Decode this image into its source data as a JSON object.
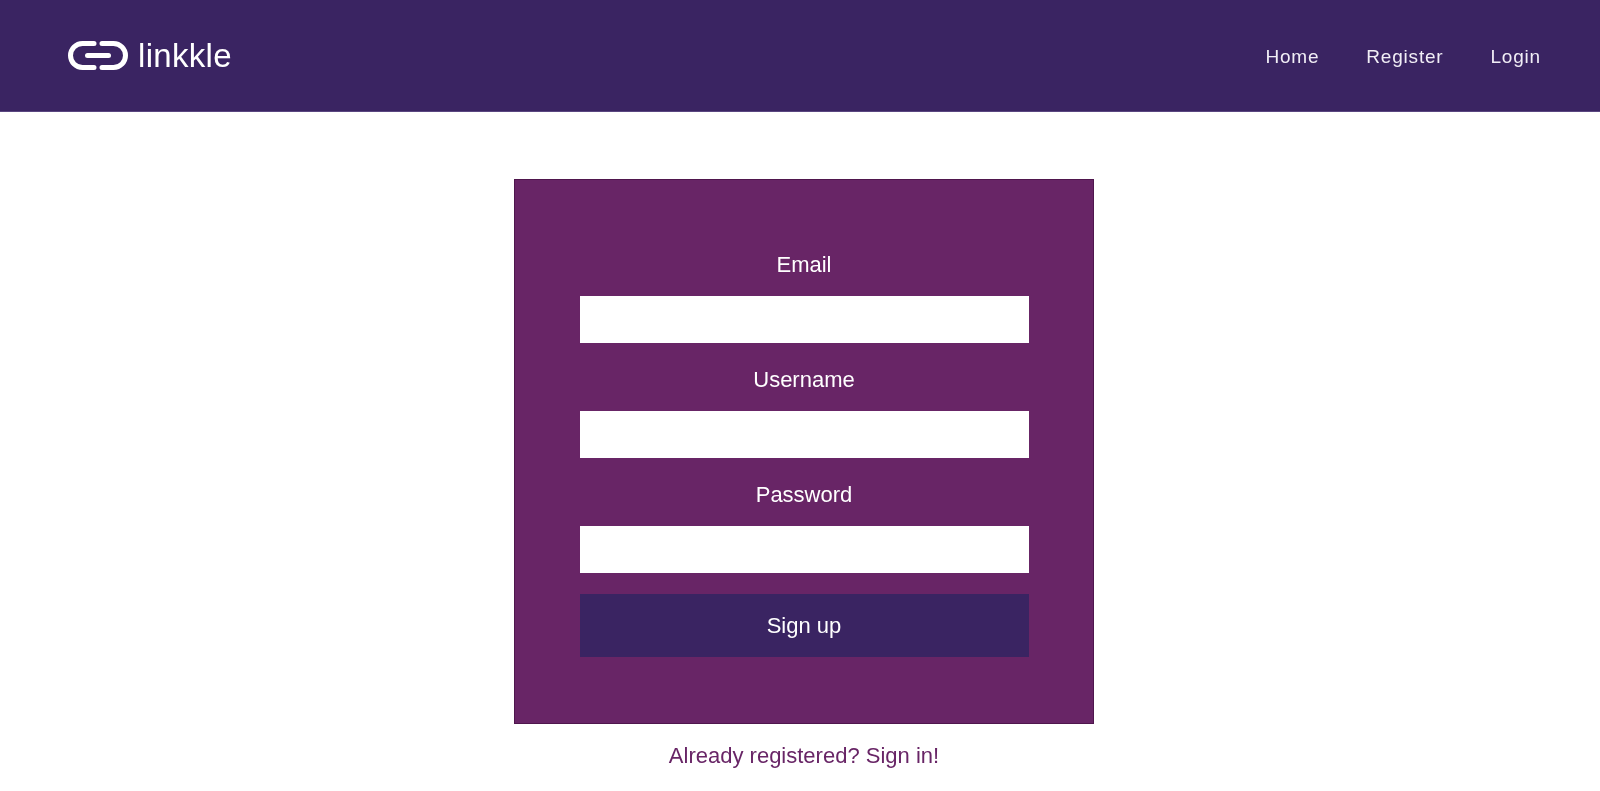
{
  "header": {
    "logo": {
      "text": "linkkle"
    },
    "nav": [
      {
        "label": "Home"
      },
      {
        "label": "Register"
      },
      {
        "label": "Login"
      }
    ]
  },
  "form": {
    "fields": [
      {
        "label": "Email"
      },
      {
        "label": "Username"
      },
      {
        "label": "Password"
      }
    ],
    "submit": {
      "label": "Sign up"
    }
  },
  "sign_in_link": {
    "label": "Already registered? Sign in!"
  }
}
